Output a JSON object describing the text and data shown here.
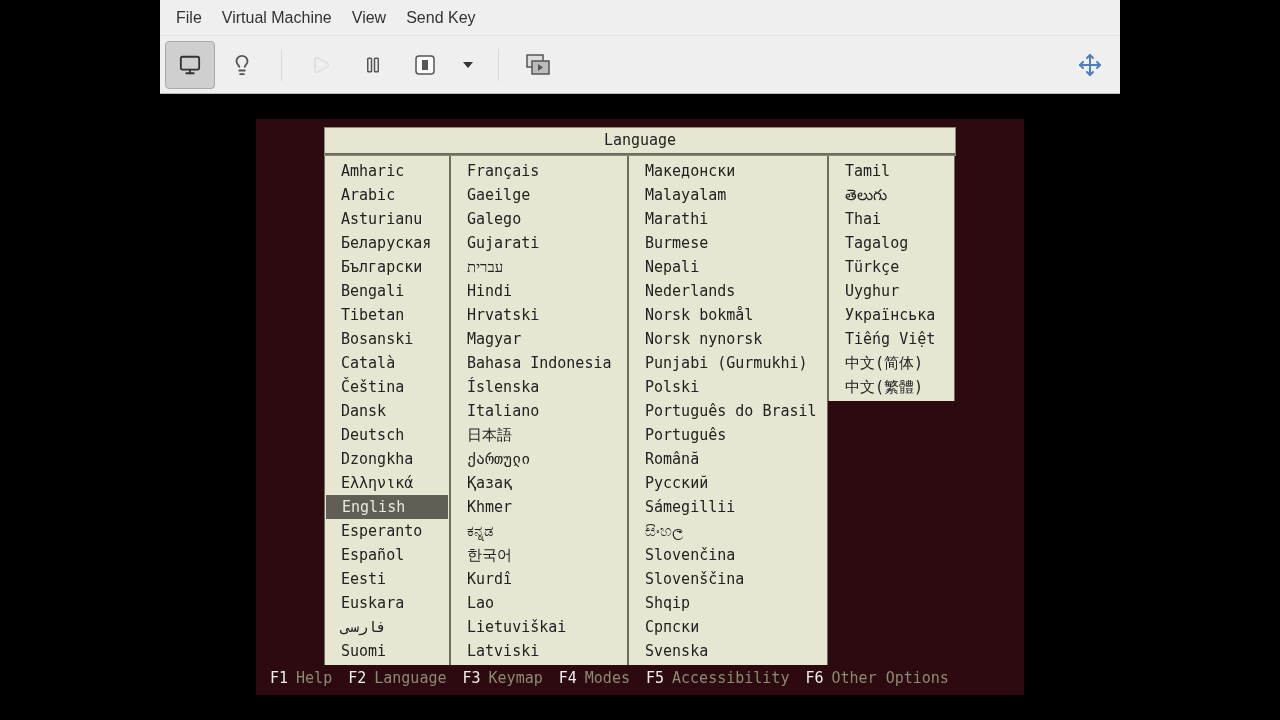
{
  "menu": [
    "File",
    "Virtual Machine",
    "View",
    "Send Key"
  ],
  "toolbar": {
    "view_buttons": [
      {
        "kind": "console",
        "selected": true
      },
      {
        "kind": "details",
        "selected": false
      }
    ],
    "actions": [
      {
        "kind": "run",
        "disabled": true
      },
      {
        "kind": "pause",
        "disabled": false
      },
      {
        "kind": "shutdown",
        "disabled": false
      },
      {
        "kind": "dropdown",
        "disabled": false
      }
    ],
    "extras": [
      {
        "kind": "snapshots"
      }
    ],
    "right": [
      {
        "kind": "fullscreen"
      }
    ]
  },
  "dialog": {
    "title": "Language",
    "columns": [
      [
        {
          "name": "Amharic",
          "selected": false
        },
        {
          "name": "Arabic",
          "selected": false
        },
        {
          "name": "Asturianu",
          "selected": false
        },
        {
          "name": "Беларуская",
          "selected": false
        },
        {
          "name": "Български",
          "selected": false
        },
        {
          "name": "Bengali",
          "selected": false
        },
        {
          "name": "Tibetan",
          "selected": false
        },
        {
          "name": "Bosanski",
          "selected": false
        },
        {
          "name": "Català",
          "selected": false
        },
        {
          "name": "Čeština",
          "selected": false
        },
        {
          "name": "Dansk",
          "selected": false
        },
        {
          "name": "Deutsch",
          "selected": false
        },
        {
          "name": "Dzongkha",
          "selected": false
        },
        {
          "name": "Ελληνικά",
          "selected": false
        },
        {
          "name": "English",
          "selected": true
        },
        {
          "name": "Esperanto",
          "selected": false
        },
        {
          "name": "Español",
          "selected": false
        },
        {
          "name": "Eesti",
          "selected": false
        },
        {
          "name": "Euskara",
          "selected": false
        },
        {
          "name": "فارسی",
          "selected": false
        },
        {
          "name": "Suomi",
          "selected": false
        }
      ],
      [
        {
          "name": "Français",
          "selected": false
        },
        {
          "name": "Gaeilge",
          "selected": false
        },
        {
          "name": "Galego",
          "selected": false
        },
        {
          "name": "Gujarati",
          "selected": false
        },
        {
          "name": "עברית",
          "selected": false
        },
        {
          "name": "Hindi",
          "selected": false
        },
        {
          "name": "Hrvatski",
          "selected": false
        },
        {
          "name": "Magyar",
          "selected": false
        },
        {
          "name": "Bahasa Indonesia",
          "selected": false
        },
        {
          "name": "Íslenska",
          "selected": false
        },
        {
          "name": "Italiano",
          "selected": false
        },
        {
          "name": "日本語",
          "selected": false
        },
        {
          "name": "ქართული",
          "selected": false
        },
        {
          "name": "Қазақ",
          "selected": false
        },
        {
          "name": "Khmer",
          "selected": false
        },
        {
          "name": "ಕನ್ನಡ",
          "selected": false
        },
        {
          "name": "한국어",
          "selected": false
        },
        {
          "name": "Kurdî",
          "selected": false
        },
        {
          "name": "Lao",
          "selected": false
        },
        {
          "name": "Lietuviškai",
          "selected": false
        },
        {
          "name": "Latviski",
          "selected": false
        }
      ],
      [
        {
          "name": "Македонски",
          "selected": false
        },
        {
          "name": "Malayalam",
          "selected": false
        },
        {
          "name": "Marathi",
          "selected": false
        },
        {
          "name": "Burmese",
          "selected": false
        },
        {
          "name": "Nepali",
          "selected": false
        },
        {
          "name": "Nederlands",
          "selected": false
        },
        {
          "name": "Norsk bokmål",
          "selected": false
        },
        {
          "name": "Norsk nynorsk",
          "selected": false
        },
        {
          "name": "Punjabi (Gurmukhi)",
          "selected": false
        },
        {
          "name": "Polski",
          "selected": false
        },
        {
          "name": "Português do Brasil",
          "selected": false
        },
        {
          "name": "Português",
          "selected": false
        },
        {
          "name": "Română",
          "selected": false
        },
        {
          "name": "Русский",
          "selected": false
        },
        {
          "name": "Sámegillii",
          "selected": false
        },
        {
          "name": "සිංහල",
          "selected": false
        },
        {
          "name": "Slovenčina",
          "selected": false
        },
        {
          "name": "Slovenščina",
          "selected": false
        },
        {
          "name": "Shqip",
          "selected": false
        },
        {
          "name": "Српски",
          "selected": false
        },
        {
          "name": "Svenska",
          "selected": false
        }
      ],
      [
        {
          "name": "Tamil",
          "selected": false
        },
        {
          "name": "తెలుగు",
          "selected": false
        },
        {
          "name": "Thai",
          "selected": false
        },
        {
          "name": "Tagalog",
          "selected": false
        },
        {
          "name": "Türkçe",
          "selected": false
        },
        {
          "name": "Uyghur",
          "selected": false
        },
        {
          "name": "Українська",
          "selected": false
        },
        {
          "name": "Tiếng Việt",
          "selected": false
        },
        {
          "name": "中文(简体)",
          "selected": false
        },
        {
          "name": "中文(繁體)",
          "selected": false
        }
      ]
    ]
  },
  "footer": [
    {
      "key": "F1",
      "label": "Help"
    },
    {
      "key": "F2",
      "label": "Language"
    },
    {
      "key": "F3",
      "label": "Keymap"
    },
    {
      "key": "F4",
      "label": "Modes"
    },
    {
      "key": "F5",
      "label": "Accessibility"
    },
    {
      "key": "F6",
      "label": "Other Options"
    }
  ]
}
